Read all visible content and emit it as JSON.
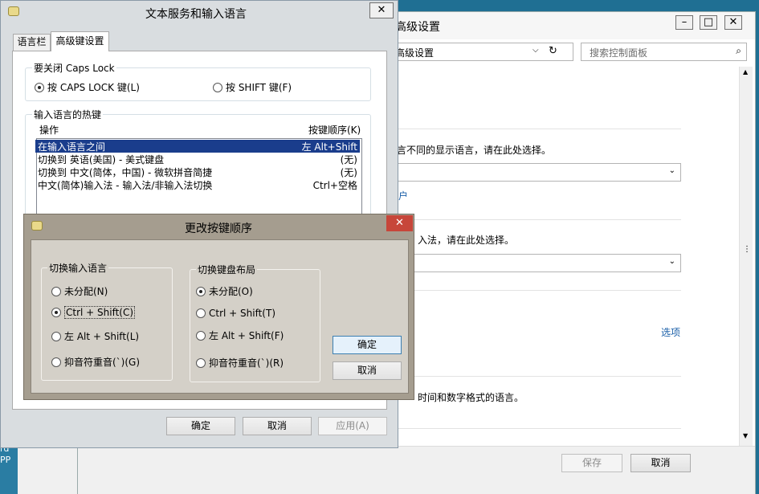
{
  "cp": {
    "title": "高级设置",
    "address": "高级设置",
    "search_placeholder": "搜索控制面板",
    "line1": "言不同的显示语言，请在此处选择。",
    "link1": "户",
    "line2": "入法，请在此处选择。",
    "options_link": "选项",
    "line3": "时间和数字格式的语言。",
    "save": "保存",
    "cancel": "取消"
  },
  "taskbar_text": "rd\nPP",
  "ts": {
    "title": "文本服务和输入语言",
    "tabs": [
      "语言栏",
      "高级键设置"
    ],
    "capslock_group": "要关闭 Caps Lock",
    "capslock_opt1": "按 CAPS LOCK 键(L)",
    "capslock_opt2": "按 SHIFT 键(F)",
    "hotkeys_group": "输入语言的热键",
    "col_action": "操作",
    "col_keys": "按键顺序(K)",
    "rows": [
      {
        "action": "在输入语言之间",
        "keys": "左 Alt+Shift"
      },
      {
        "action": "切换到 英语(美国) - 美式键盘",
        "keys": "(无)"
      },
      {
        "action": "切换到 中文(简体，中国) - 微软拼音简捷",
        "keys": "(无)"
      },
      {
        "action": "中文(简体)输入法 - 输入法/非输入法切换",
        "keys": "Ctrl+空格"
      }
    ],
    "ok": "确定",
    "cancel": "取消",
    "apply": "应用(A)"
  },
  "ck": {
    "title": "更改按键顺序",
    "close": "✕",
    "group1": "切换输入语言",
    "g1_opts": [
      "未分配(N)",
      "Ctrl + Shift(C)",
      "左 Alt + Shift(L)",
      "抑音符重音(`)(G)"
    ],
    "group2": "切换键盘布局",
    "g2_opts": [
      "未分配(O)",
      "Ctrl + Shift(T)",
      "左 Alt + Shift(F)",
      "抑音符重音(`)(R)"
    ],
    "ok": "确定",
    "cancel": "取消"
  }
}
